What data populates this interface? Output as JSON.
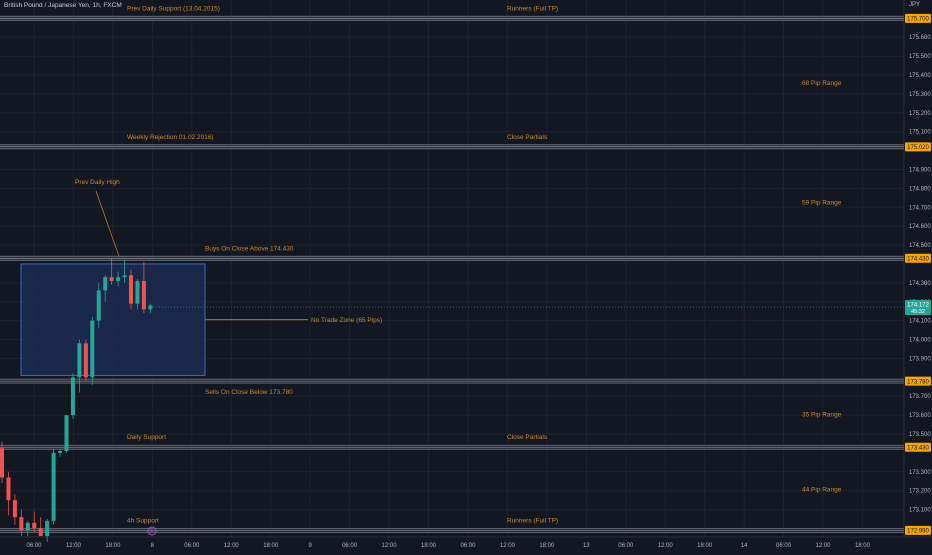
{
  "header": {
    "title": "British Pound / Japanese Yen, 1h, FXCM",
    "currency": "JPY"
  },
  "colors": {
    "background": "#131722",
    "grid": "#1e222d",
    "up": "#26a69a",
    "down": "#ef5350",
    "level_line": "#6b6f7a",
    "annotation": "#c98a2b",
    "zone_fill": "#1c2f55",
    "zone_border": "#3f6bb8",
    "axis_text": "#b2b5be",
    "price_badge_bg": "#f7a600",
    "price_badge_text": "#131722",
    "current_price_bg": "#26a69a",
    "event_marker": "#9c4fd6"
  },
  "chart_data": {
    "type": "candlestick",
    "y_axis": {
      "range": [
        172.955,
        175.797
      ],
      "ticks": [
        "175.600",
        "175.500",
        "175.400",
        "175.300",
        "175.200",
        "175.100",
        "174.900",
        "174.800",
        "174.700",
        "174.600",
        "174.500",
        "174.300",
        "174.200",
        "174.100",
        "174.000",
        "173.900",
        "173.700",
        "173.600",
        "173.500",
        "173.300",
        "173.200",
        "173.100"
      ]
    },
    "x_axis": {
      "ticks": [
        "06:00",
        "12:00",
        "18:00",
        "8",
        "06:00",
        "12:00",
        "18:00",
        "9",
        "06:00",
        "12:00",
        "18:00",
        "06:00",
        "12:00",
        "18:00",
        "13",
        "06:00",
        "12:00",
        "18:00",
        "14",
        "06:00",
        "12:00",
        "18:00"
      ]
    },
    "levels": [
      {
        "price": 175.7,
        "label": "175.700",
        "left_note": "Prev Daily Support (13.04.2015)",
        "right_note": "Runners (Full TP)"
      },
      {
        "price": 175.02,
        "label": "175.020",
        "left_note": "Weekly Rejection 01.02.2016)",
        "right_note": "Close Partials"
      },
      {
        "price": 174.43,
        "label": "174.430",
        "left_note": "Buys On Close Above 174.430",
        "right_note": ""
      },
      {
        "price": 173.78,
        "label": "173.780",
        "left_note": "Sells On Close Below 173.780",
        "right_note": ""
      },
      {
        "price": 173.43,
        "label": "173.430",
        "left_note": "Daily Support",
        "right_note": "Close Partials"
      },
      {
        "price": 172.99,
        "label": "172.990",
        "left_note": "4h Support",
        "right_note": "Runners (Full TP)"
      }
    ],
    "range_notes": [
      {
        "text": "68 Pip Range",
        "price": 175.36
      },
      {
        "text": "59 Pip Range",
        "price": 174.727
      },
      {
        "text": "35 Pip Range",
        "price": 173.605
      },
      {
        "text": "44 Pip Range",
        "price": 173.21
      }
    ],
    "zone": {
      "label": "No Trade Zone (65 Pips)",
      "top": 174.4,
      "bottom": 173.81
    },
    "callout": {
      "text": "Prev Daily High",
      "price": 174.43
    },
    "current_price": {
      "value": "174.172",
      "countdown": "45:32"
    },
    "event_marker": "P",
    "candles": [
      {
        "o": 173.425,
        "h": 173.46,
        "l": 173.24,
        "c": 173.27
      },
      {
        "o": 173.27,
        "h": 173.3,
        "l": 173.07,
        "c": 173.15
      },
      {
        "o": 173.15,
        "h": 173.18,
        "l": 173.02,
        "c": 173.06
      },
      {
        "o": 173.06,
        "h": 173.1,
        "l": 172.96,
        "c": 172.99
      },
      {
        "o": 172.99,
        "h": 173.04,
        "l": 172.96,
        "c": 173.03
      },
      {
        "o": 173.03,
        "h": 173.09,
        "l": 172.98,
        "c": 173.0
      },
      {
        "o": 173.0,
        "h": 173.06,
        "l": 172.96,
        "c": 172.96
      },
      {
        "o": 172.96,
        "h": 173.05,
        "l": 172.93,
        "c": 173.04
      },
      {
        "o": 173.04,
        "h": 173.42,
        "l": 173.02,
        "c": 173.4
      },
      {
        "o": 173.4,
        "h": 173.42,
        "l": 173.38,
        "c": 173.41
      },
      {
        "o": 173.41,
        "h": 173.6,
        "l": 173.4,
        "c": 173.6
      },
      {
        "o": 173.6,
        "h": 173.82,
        "l": 173.58,
        "c": 173.8
      },
      {
        "o": 173.8,
        "h": 174.0,
        "l": 173.72,
        "c": 173.98
      },
      {
        "o": 173.98,
        "h": 174.0,
        "l": 173.78,
        "c": 173.8
      },
      {
        "o": 173.8,
        "h": 174.12,
        "l": 173.76,
        "c": 174.1
      },
      {
        "o": 174.1,
        "h": 174.3,
        "l": 174.06,
        "c": 174.26
      },
      {
        "o": 174.26,
        "h": 174.34,
        "l": 174.2,
        "c": 174.33
      },
      {
        "o": 174.33,
        "h": 174.43,
        "l": 174.29,
        "c": 174.31
      },
      {
        "o": 174.31,
        "h": 174.36,
        "l": 174.28,
        "c": 174.33
      },
      {
        "o": 174.33,
        "h": 174.42,
        "l": 174.3,
        "c": 174.34
      },
      {
        "o": 174.34,
        "h": 174.37,
        "l": 174.16,
        "c": 174.19
      },
      {
        "o": 174.19,
        "h": 174.32,
        "l": 174.16,
        "c": 174.31
      },
      {
        "o": 174.31,
        "h": 174.41,
        "l": 174.14,
        "c": 174.16
      },
      {
        "o": 174.16,
        "h": 174.19,
        "l": 174.14,
        "c": 174.18
      }
    ]
  }
}
